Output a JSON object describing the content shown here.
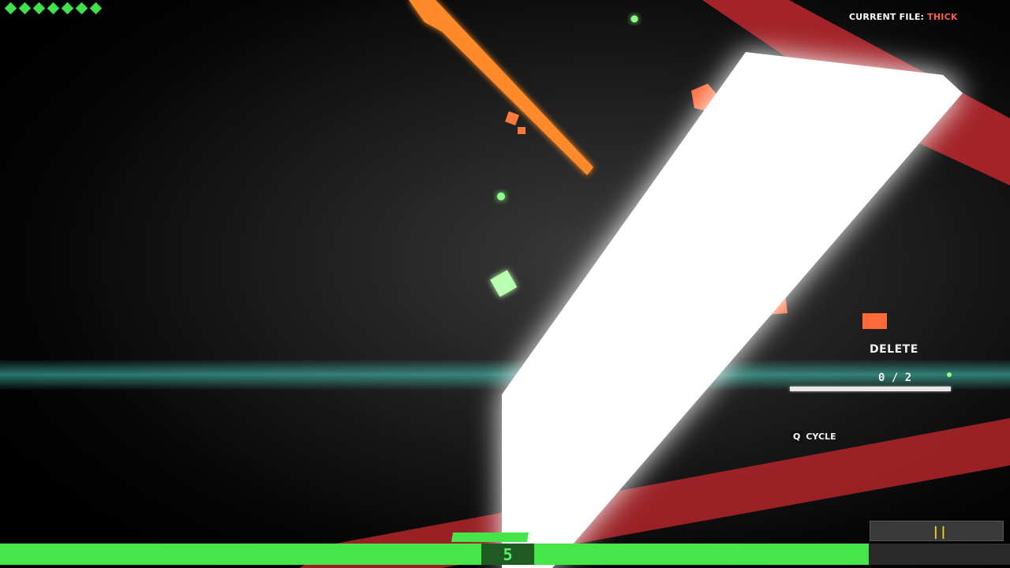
{
  "hud": {
    "lives_count": 7,
    "lives_color": "#3fe24c",
    "current_file_label": "CURRENT FILE:",
    "current_file_name": "THICK",
    "current_file_name_color": "#ff5a4c",
    "action_label": "DELETE",
    "action_progress_text": "0 / 2",
    "action_progress": 0,
    "cycle_key": "Q",
    "cycle_label": "CYCLE",
    "health_fraction": 0.86,
    "health_color": "#46e64a",
    "level": "5",
    "ammo_glyph": "||",
    "ammo_color": "#f5d21e"
  },
  "scene": {
    "beam_color": "#ffffff",
    "laser_color": "#ff8a2a",
    "danger_band_color": "#b3262b",
    "horizon_glow_color": "#47d6c2",
    "particle_green": "#8dff8a",
    "particle_orange": "#ff6a3a"
  }
}
